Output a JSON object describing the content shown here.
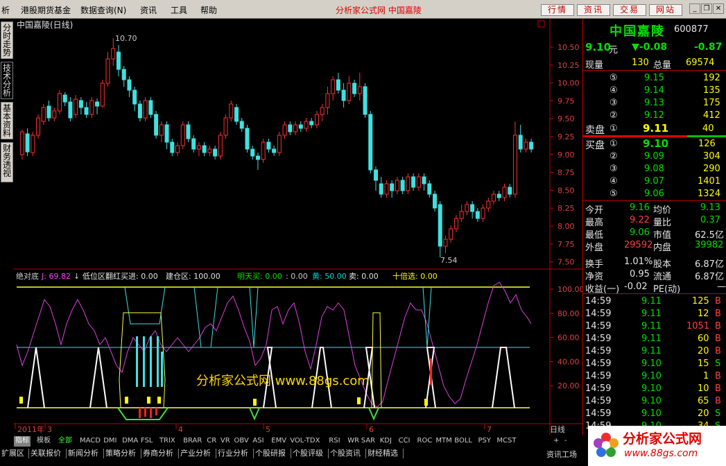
{
  "menu": {
    "items": [
      "析",
      "港股期货基金",
      "数据查询(N)",
      "资讯",
      "工具",
      "帮助"
    ],
    "brand": "分析家公式网 中国嘉陵",
    "buttons": [
      "行情",
      "资讯",
      "交易",
      "网站"
    ]
  },
  "left_tabs": [
    "分时走势",
    "技术分析",
    "基本资料",
    "财务透视"
  ],
  "chart": {
    "title": "中国嘉陵(日线)",
    "price_ticks": [
      "10.50",
      "10.25",
      "10.00",
      "9.75",
      "9.50",
      "9.25",
      "9.00",
      "8.75",
      "8.50",
      "8.25",
      "8.00",
      "7.75",
      "7.50"
    ],
    "high_marker": "10.70",
    "low_marker": "7.54",
    "indicator_line": {
      "name": "绝对底",
      "j_label": "J: 69.82",
      "low_label": "低位区翻红买进: 0.00",
      "build_label": "建仓区: 100.00",
      "next_day_label": "明天买: 0.00",
      "colon_label": ": 0.00",
      "yellow_label": "黄: 50.00",
      "sell_label": "卖: 0.00",
      "ten_label": "十倍选: 0.00"
    },
    "indicator_ticks": [
      "100.00",
      "80.00",
      "60.00",
      "40.00",
      "20.00"
    ],
    "date_labels": [
      "2011年",
      "3",
      "4",
      "5",
      "6",
      "7"
    ],
    "period": "日线",
    "watermark": "分析家公式网 www.88gs.com"
  },
  "chart_data": {
    "type": "candlestick",
    "ylim": [
      7.45,
      10.8
    ],
    "candles": [
      [
        9.02,
        9.35,
        8.95,
        9.38
      ],
      [
        9.32,
        9.06,
        9.0,
        9.4
      ],
      [
        9.05,
        9.3,
        9.0,
        9.35
      ],
      [
        9.3,
        9.55,
        9.25,
        9.6
      ],
      [
        9.5,
        9.7,
        9.45,
        9.75
      ],
      [
        9.72,
        9.55,
        9.5,
        9.8
      ],
      [
        9.55,
        9.65,
        9.5,
        9.7
      ],
      [
        9.65,
        9.9,
        9.6,
        9.95
      ],
      [
        9.88,
        9.78,
        9.72,
        9.92
      ],
      [
        9.78,
        9.55,
        9.5,
        9.85
      ],
      [
        9.6,
        9.82,
        9.55,
        9.88
      ],
      [
        9.8,
        9.7,
        9.6,
        9.85
      ],
      [
        9.7,
        9.6,
        9.55,
        9.78
      ],
      [
        9.6,
        9.8,
        9.55,
        9.85
      ],
      [
        9.78,
        9.72,
        9.6,
        9.83
      ],
      [
        9.72,
        10.05,
        9.7,
        10.1
      ],
      [
        10.05,
        10.4,
        10.0,
        10.5
      ],
      [
        10.4,
        10.55,
        10.3,
        10.7
      ],
      [
        10.5,
        10.25,
        10.15,
        10.6
      ],
      [
        10.25,
        10.1,
        10.0,
        10.3
      ],
      [
        10.1,
        9.95,
        9.85,
        10.15
      ],
      [
        9.95,
        9.75,
        9.65,
        10.0
      ],
      [
        9.75,
        9.55,
        9.5,
        9.8
      ],
      [
        9.55,
        9.8,
        9.5,
        9.85
      ],
      [
        9.8,
        9.6,
        9.55,
        9.85
      ],
      [
        9.6,
        9.3,
        9.25,
        9.65
      ],
      [
        9.3,
        9.45,
        9.2,
        9.5
      ],
      [
        9.45,
        9.2,
        9.1,
        9.5
      ],
      [
        9.2,
        9.05,
        9.0,
        9.25
      ],
      [
        9.05,
        9.15,
        9.0,
        9.2
      ],
      [
        9.15,
        9.45,
        9.1,
        9.5
      ],
      [
        9.45,
        9.25,
        9.2,
        9.5
      ],
      [
        9.25,
        9.1,
        9.05,
        9.3
      ],
      [
        9.1,
        9.15,
        9.0,
        9.2
      ],
      [
        9.15,
        9.05,
        9.0,
        9.2
      ],
      [
        9.05,
        9.1,
        9.0,
        9.15
      ],
      [
        9.1,
        9.0,
        8.95,
        9.15
      ],
      [
        9.0,
        9.3,
        8.95,
        9.35
      ],
      [
        9.3,
        9.55,
        9.25,
        9.6
      ],
      [
        9.55,
        9.75,
        9.5,
        9.8
      ],
      [
        9.7,
        9.5,
        9.45,
        9.75
      ],
      [
        9.5,
        9.4,
        9.35,
        9.55
      ],
      [
        9.4,
        9.1,
        9.05,
        9.45
      ],
      [
        9.1,
        9.0,
        8.95,
        9.15
      ],
      [
        9.0,
        8.95,
        8.8,
        9.05
      ],
      [
        8.95,
        9.2,
        8.9,
        9.25
      ],
      [
        9.2,
        9.1,
        9.05,
        9.25
      ],
      [
        9.1,
        9.05,
        9.0,
        9.15
      ],
      [
        9.05,
        9.3,
        9.0,
        9.35
      ],
      [
        9.3,
        9.45,
        9.25,
        9.5
      ],
      [
        9.45,
        9.35,
        9.3,
        9.5
      ],
      [
        9.35,
        9.45,
        9.3,
        9.5
      ],
      [
        9.45,
        9.4,
        9.35,
        9.5
      ],
      [
        9.4,
        9.5,
        9.35,
        9.55
      ],
      [
        9.5,
        9.45,
        9.4,
        9.55
      ],
      [
        9.45,
        9.6,
        9.4,
        9.65
      ],
      [
        9.6,
        9.7,
        9.5,
        9.75
      ],
      [
        9.7,
        9.9,
        9.6,
        10.0
      ],
      [
        9.9,
        10.1,
        9.8,
        10.15
      ],
      [
        10.1,
        9.95,
        9.9,
        10.2
      ],
      [
        9.95,
        9.8,
        9.7,
        10.05
      ],
      [
        9.8,
        10.05,
        9.75,
        10.15
      ],
      [
        10.05,
        9.9,
        9.85,
        10.1
      ],
      [
        9.9,
        10.0,
        9.8,
        10.2
      ],
      [
        10.0,
        9.6,
        9.55,
        10.05
      ],
      [
        9.6,
        8.8,
        8.75,
        9.65
      ],
      [
        8.8,
        8.65,
        8.5,
        8.85
      ],
      [
        8.6,
        8.45,
        8.4,
        8.7
      ],
      [
        8.45,
        8.6,
        8.4,
        8.65
      ],
      [
        8.6,
        8.5,
        8.4,
        8.65
      ],
      [
        8.5,
        8.65,
        8.45,
        8.7
      ],
      [
        8.65,
        8.5,
        8.45,
        8.7
      ],
      [
        8.5,
        8.7,
        8.45,
        8.75
      ],
      [
        8.7,
        8.55,
        8.5,
        8.75
      ],
      [
        8.55,
        8.7,
        8.5,
        8.75
      ],
      [
        8.7,
        8.6,
        8.5,
        8.75
      ],
      [
        8.6,
        8.45,
        8.4,
        8.65
      ],
      [
        8.45,
        8.25,
        8.2,
        8.5
      ],
      [
        8.3,
        7.7,
        7.54,
        8.35
      ],
      [
        7.7,
        7.8,
        7.6,
        7.85
      ],
      [
        7.8,
        7.95,
        7.75,
        8.0
      ],
      [
        7.95,
        8.1,
        7.9,
        8.15
      ],
      [
        8.1,
        8.2,
        8.05,
        8.3
      ],
      [
        8.2,
        8.3,
        8.15,
        8.35
      ],
      [
        8.3,
        8.2,
        8.1,
        8.35
      ],
      [
        8.2,
        8.1,
        8.05,
        8.25
      ],
      [
        8.1,
        8.25,
        8.05,
        8.3
      ],
      [
        8.25,
        8.35,
        8.2,
        8.4
      ],
      [
        8.35,
        8.45,
        8.3,
        8.5
      ],
      [
        8.45,
        8.4,
        8.35,
        8.5
      ],
      [
        8.4,
        8.55,
        8.35,
        8.6
      ],
      [
        8.55,
        8.45,
        8.4,
        8.6
      ],
      [
        8.45,
        9.3,
        8.4,
        9.5
      ],
      [
        9.3,
        9.1,
        9.05,
        9.45
      ],
      [
        9.1,
        9.2,
        9.05,
        9.25
      ],
      [
        9.2,
        9.1,
        9.05,
        9.25
      ]
    ]
  },
  "quote": {
    "name": "中国嘉陵",
    "code": "600877",
    "price": "9.10",
    "unit": "元",
    "change": "▼-0.08",
    "pct": "-0.87",
    "xianliang_label": "现量",
    "xianliang": "130",
    "zongliang_label": "总量",
    "zongliang": "69574",
    "sell": [
      [
        "⑤",
        "9.15",
        "192"
      ],
      [
        "④",
        "9.14",
        "135"
      ],
      [
        "③",
        "9.13",
        "175"
      ],
      [
        "②",
        "9.12",
        "412"
      ]
    ],
    "sell1": {
      "label": "卖盘",
      "n": "①",
      "p": "9.11",
      "v": "40"
    },
    "buy1": {
      "label": "买盘",
      "n": "①",
      "p": "9.10",
      "v": "126"
    },
    "buy": [
      [
        "②",
        "9.09",
        "304"
      ],
      [
        "③",
        "9.08",
        "290"
      ],
      [
        "④",
        "9.07",
        "1401"
      ],
      [
        "⑤",
        "9.06",
        "1324"
      ]
    ],
    "stats": [
      [
        "今开",
        "9.16",
        "均价",
        "9.13"
      ],
      [
        "最高",
        "9.22",
        "量比",
        "0.37"
      ],
      [
        "最低",
        "9.06",
        "市值",
        "62.5亿"
      ],
      [
        "外盘",
        "29592",
        "内盘",
        "39982"
      ],
      [
        "换手",
        "1.01%",
        "股本",
        "6.87亿"
      ],
      [
        "净资",
        "0.95",
        "流通",
        "6.87亿"
      ],
      [
        "收益(一)",
        "-0.02",
        "PE(动)",
        "—"
      ]
    ],
    "ticks": [
      [
        "14:59",
        "9.11",
        "125",
        "B"
      ],
      [
        "14:59",
        "9.11",
        "12",
        "B"
      ],
      [
        "14:59",
        "9.11",
        "1051",
        "B"
      ],
      [
        "14:59",
        "9.11",
        "60",
        "B"
      ],
      [
        "14:59",
        "9.11",
        "20",
        "B"
      ],
      [
        "14:59",
        "9.10",
        "15",
        "S"
      ],
      [
        "14:59",
        "9.10",
        "1",
        "B"
      ],
      [
        "14:59",
        "9.10",
        "10",
        "B"
      ],
      [
        "14:59",
        "9.10",
        "65",
        "B"
      ],
      [
        "14:59",
        "9.10",
        "20",
        "S"
      ],
      [
        "14:59",
        "9.10",
        "34",
        "S"
      ]
    ]
  },
  "indicator_tabs": [
    "指标",
    "模板",
    "全部",
    "MACD",
    "DMI",
    "DMA",
    "FSL",
    "TRIX",
    "BRAR",
    "CR",
    "VR",
    "OBV",
    "ASI",
    "EMV",
    "VOL-TDX",
    "RSI",
    "WR",
    "SAR",
    "KDJ",
    "CCI",
    "ROC",
    "MTM",
    "BOLL",
    "PSY",
    "MCST"
  ],
  "bottom_tabs": [
    "扩展区",
    "关联报价",
    "新闻分析",
    "策略分析",
    "券商分析",
    "产业分析",
    "行业分析",
    "个股研报",
    "个股评级",
    "个股资讯",
    "财经精选"
  ],
  "bottom_right": "资讯工场",
  "logo": {
    "text": "分析家公式网",
    "url": "www.88gs.com"
  }
}
